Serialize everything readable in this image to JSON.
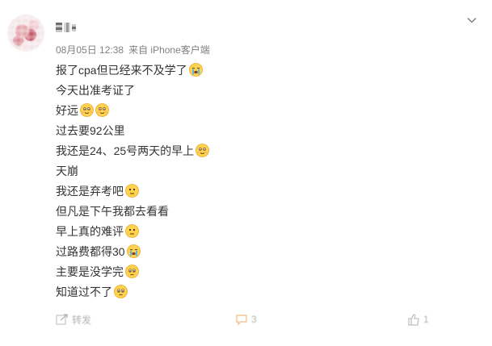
{
  "post": {
    "meta": {
      "date": "08月05日 12:38",
      "source": "来自 iPhone客户端"
    },
    "lines": [
      {
        "text": "报了cpa但已经来不及学了",
        "emojis": [
          "crying-emoji"
        ]
      },
      {
        "text": "今天出准考证了",
        "emojis": []
      },
      {
        "text": "好远",
        "emojis": [
          "sweat-emoji",
          "sweat-emoji"
        ]
      },
      {
        "text": "过去要92公里",
        "emojis": []
      },
      {
        "text": "我还是24、25号两天的早上",
        "emojis": [
          "sweat-emoji"
        ]
      },
      {
        "text": "天崩",
        "emojis": []
      },
      {
        "text": "我还是弃考吧",
        "emojis": [
          "speechless-emoji"
        ]
      },
      {
        "text": "但凡是下午我都去看看",
        "emojis": []
      },
      {
        "text": "早上真的难评",
        "emojis": [
          "speechless-emoji"
        ]
      },
      {
        "text": "过路费都得30",
        "emojis": [
          "crying-emoji"
        ]
      },
      {
        "text": "主要是没学完",
        "emojis": [
          "sad-emoji"
        ]
      },
      {
        "text": "知道过不了",
        "emojis": [
          "sad-emoji"
        ]
      }
    ]
  },
  "actions": {
    "share_label": "转发",
    "comment_label": "3",
    "like_label": "1"
  },
  "icons": {
    "more": "chevron-down-icon",
    "share": "share-icon",
    "comment": "comment-icon",
    "like": "thumbs-up-icon"
  }
}
